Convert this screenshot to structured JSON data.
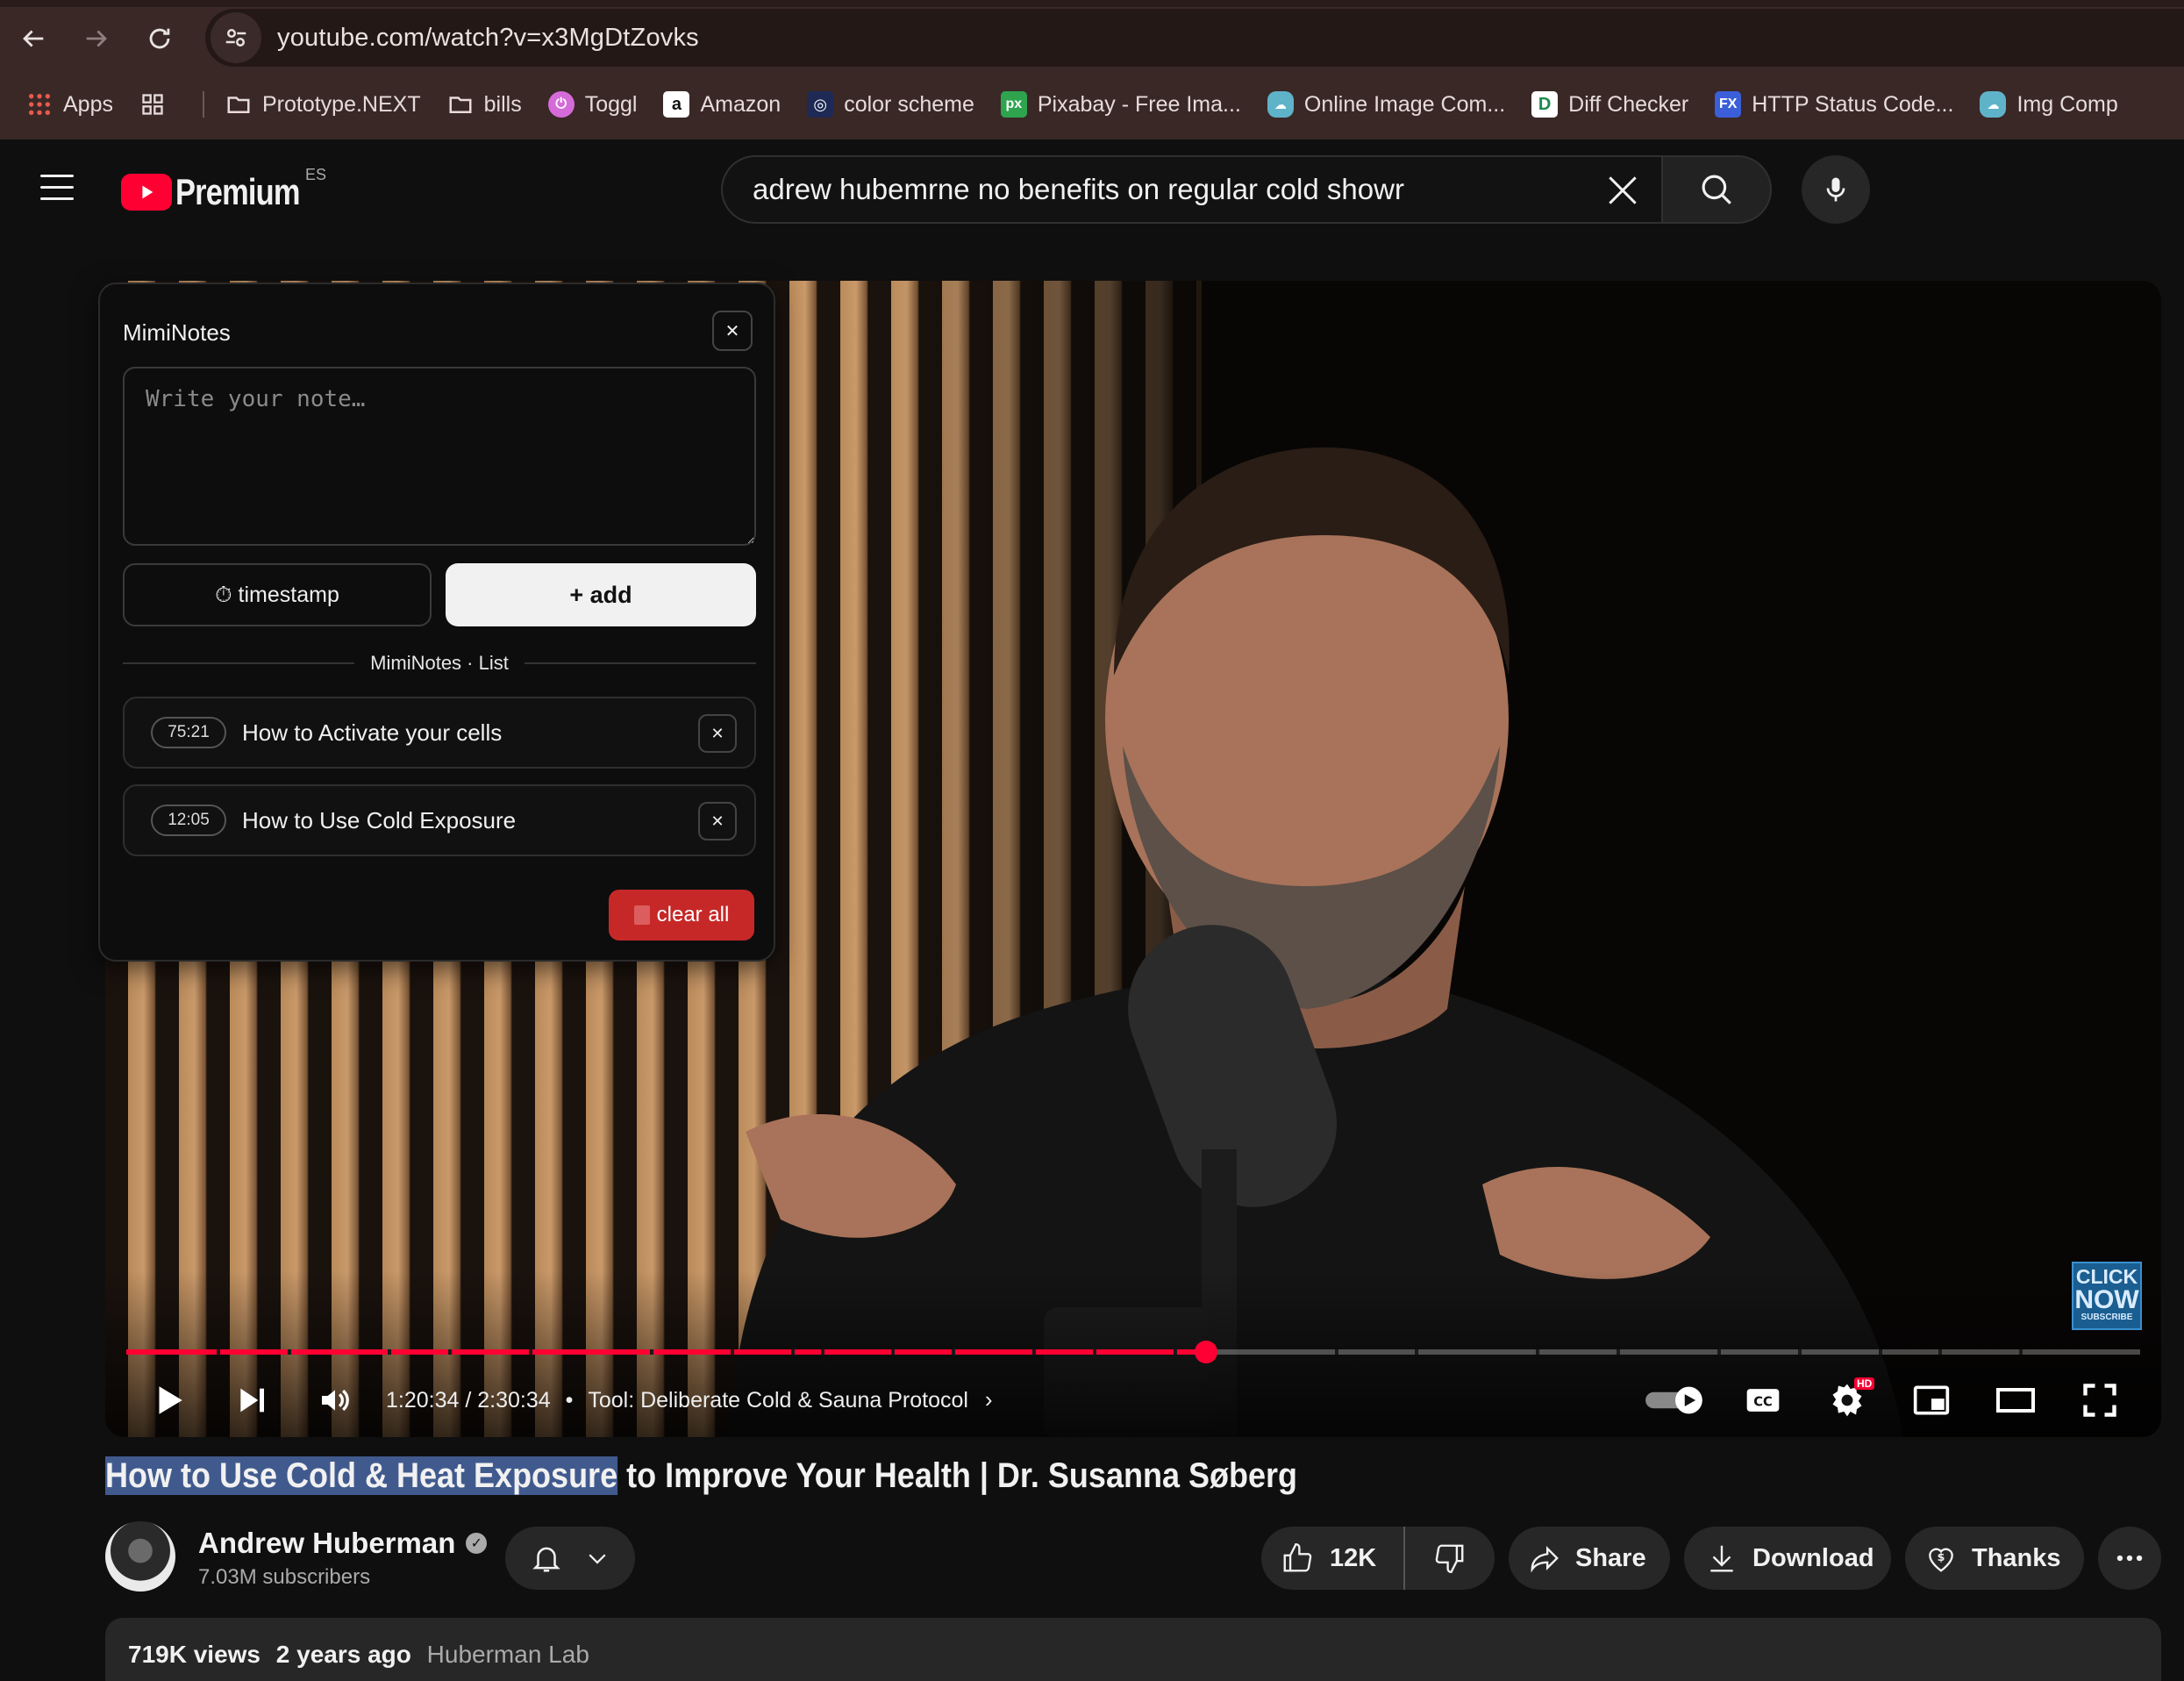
{
  "browser": {
    "url": "youtube.com/watch?v=x3MgDtZovks",
    "bookmarks": [
      {
        "label": "Apps",
        "icon": "apps-grid-icon"
      },
      {
        "label": "Prototype.NEXT",
        "icon": "folder-icon"
      },
      {
        "label": "bills",
        "icon": "folder-icon"
      },
      {
        "label": "Toggl",
        "icon": "toggl-icon"
      },
      {
        "label": "Amazon",
        "icon": "amazon-icon"
      },
      {
        "label": "color scheme",
        "icon": "color-scheme-icon"
      },
      {
        "label": "Pixabay - Free Ima...",
        "icon": "pixabay-icon"
      },
      {
        "label": "Online Image Com...",
        "icon": "cloud-icon"
      },
      {
        "label": "Diff Checker",
        "icon": "diffchecker-icon"
      },
      {
        "label": "HTTP Status Code...",
        "icon": "fx-icon"
      },
      {
        "label": "Img Comp",
        "icon": "cloud-icon"
      }
    ]
  },
  "header": {
    "brand": "Premium",
    "country": "ES",
    "search_query": "adrew hubemrne no benefits on regular cold showr"
  },
  "mimi": {
    "title": "MimiNotes",
    "placeholder": "Write your note…",
    "timestamp_label": "⏱ timestamp",
    "add_label": "+ add",
    "list_title": "MimiNotes · List",
    "notes": [
      {
        "time": "75:21",
        "text": "How to Activate your cells"
      },
      {
        "time": "12:05",
        "text": "How to Use Cold Exposure"
      }
    ],
    "clear_label": "clear all"
  },
  "player": {
    "time": "1:20:34 / 2:30:34",
    "separator": "•",
    "chapter": "Tool: Deliberate Cold & Sauna Protocol",
    "progress_fraction": 0.536,
    "hd_badge": "HD",
    "overlay": {
      "line1": "CLICK",
      "line2": "NOW",
      "line3": "SUBSCRIBE"
    }
  },
  "video": {
    "title_highlight": "How to Use Cold & Heat Exposure",
    "title_rest": " to Improve Your Health | Dr. Susanna Søberg",
    "channel": "Andrew Huberman",
    "subscribers": "7.03M subscribers",
    "likes": "12K",
    "share_label": "Share",
    "download_label": "Download",
    "thanks_label": "Thanks",
    "views": "719K views",
    "age": "2 years ago",
    "tag": "Huberman Lab"
  },
  "colors": {
    "accent": "#ff0033",
    "highlight": "#415a8e",
    "clear_button": "#c62828"
  }
}
